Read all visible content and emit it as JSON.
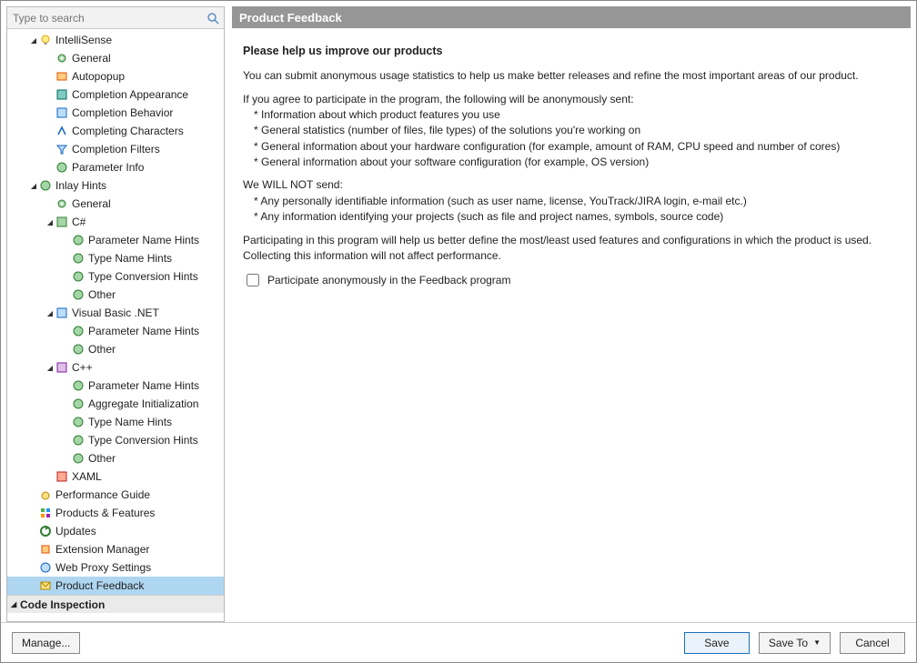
{
  "search": {
    "placeholder": "Type to search"
  },
  "sidebar": {
    "intellisense_label": "IntelliSense",
    "intellisense": {
      "general": "General",
      "autopopup": "Autopopup",
      "completion_appearance": "Completion Appearance",
      "completion_behavior": "Completion Behavior",
      "completing_characters": "Completing Characters",
      "completion_filters": "Completion Filters",
      "parameter_info": "Parameter Info"
    },
    "inlay_hints_label": "Inlay Hints",
    "inlay_hints": {
      "general": "General",
      "csharp_label": "C#",
      "csharp": {
        "param_name": "Parameter Name Hints",
        "type_name": "Type Name Hints",
        "type_conv": "Type Conversion Hints",
        "other": "Other"
      },
      "vbnet_label": "Visual Basic .NET",
      "vbnet": {
        "param_name": "Parameter Name Hints",
        "other": "Other"
      },
      "cpp_label": "C++",
      "cpp": {
        "param_name": "Parameter Name Hints",
        "agg_init": "Aggregate Initialization",
        "type_name": "Type Name Hints",
        "type_conv": "Type Conversion Hints",
        "other": "Other"
      },
      "xaml": "XAML"
    },
    "perf_guide": "Performance Guide",
    "prod_feat": "Products & Features",
    "updates": "Updates",
    "ext_mgr": "Extension Manager",
    "web_proxy": "Web Proxy Settings",
    "prod_feedback": "Product Feedback",
    "code_inspection": "Code Inspection"
  },
  "content": {
    "title": "Product Feedback",
    "heading": "Please help us improve our products",
    "p1": "You can submit anonymous usage statistics to help us make better releases and refine the most important areas of our product.",
    "p2": "If you agree to participate in the program, the following will be anonymously sent:",
    "b1": "* Information about which product features you use",
    "b2": "* General statistics (number of files, file types) of the solutions you're working on",
    "b3": "* General information about your hardware configuration (for example, amount of RAM, CPU speed and number of cores)",
    "b4": "* General information about your software configuration (for example, OS version)",
    "p3": "We WILL NOT send:",
    "b5": "* Any personally identifiable information (such as user name, license, YouTrack/JIRA login, e-mail etc.)",
    "b6": "* Any information identifying your projects (such as file and project names, symbols, source code)",
    "p4": "Participating in this program will help us better define the most/least used features and configurations in which the product is used. Collecting this information will not affect performance.",
    "checkbox_label": "Participate anonymously in the Feedback program"
  },
  "buttons": {
    "manage": "Manage...",
    "save": "Save",
    "save_to": "Save To",
    "cancel": "Cancel"
  }
}
